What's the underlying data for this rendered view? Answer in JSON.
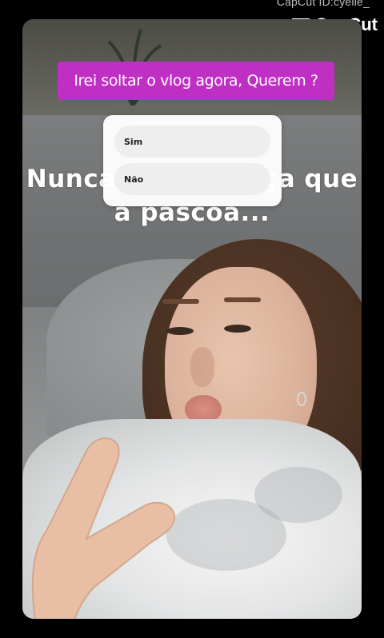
{
  "watermark": {
    "capcut_id": "CapCut ID:cyelle_",
    "logo_text": "CapCut",
    "logo_icon": "capcut-logo-icon"
  },
  "story": {
    "question_sticker": "Irei soltar o vlog agora, Querem ?",
    "poll": {
      "options": [
        {
          "label": "Sim"
        },
        {
          "label": "Não"
        }
      ]
    },
    "caption_lines": [
      "Nunca me esqueça que",
      "a pascoa..."
    ]
  },
  "colors": {
    "question_bg": "#c02fc4",
    "background": "#000000"
  }
}
